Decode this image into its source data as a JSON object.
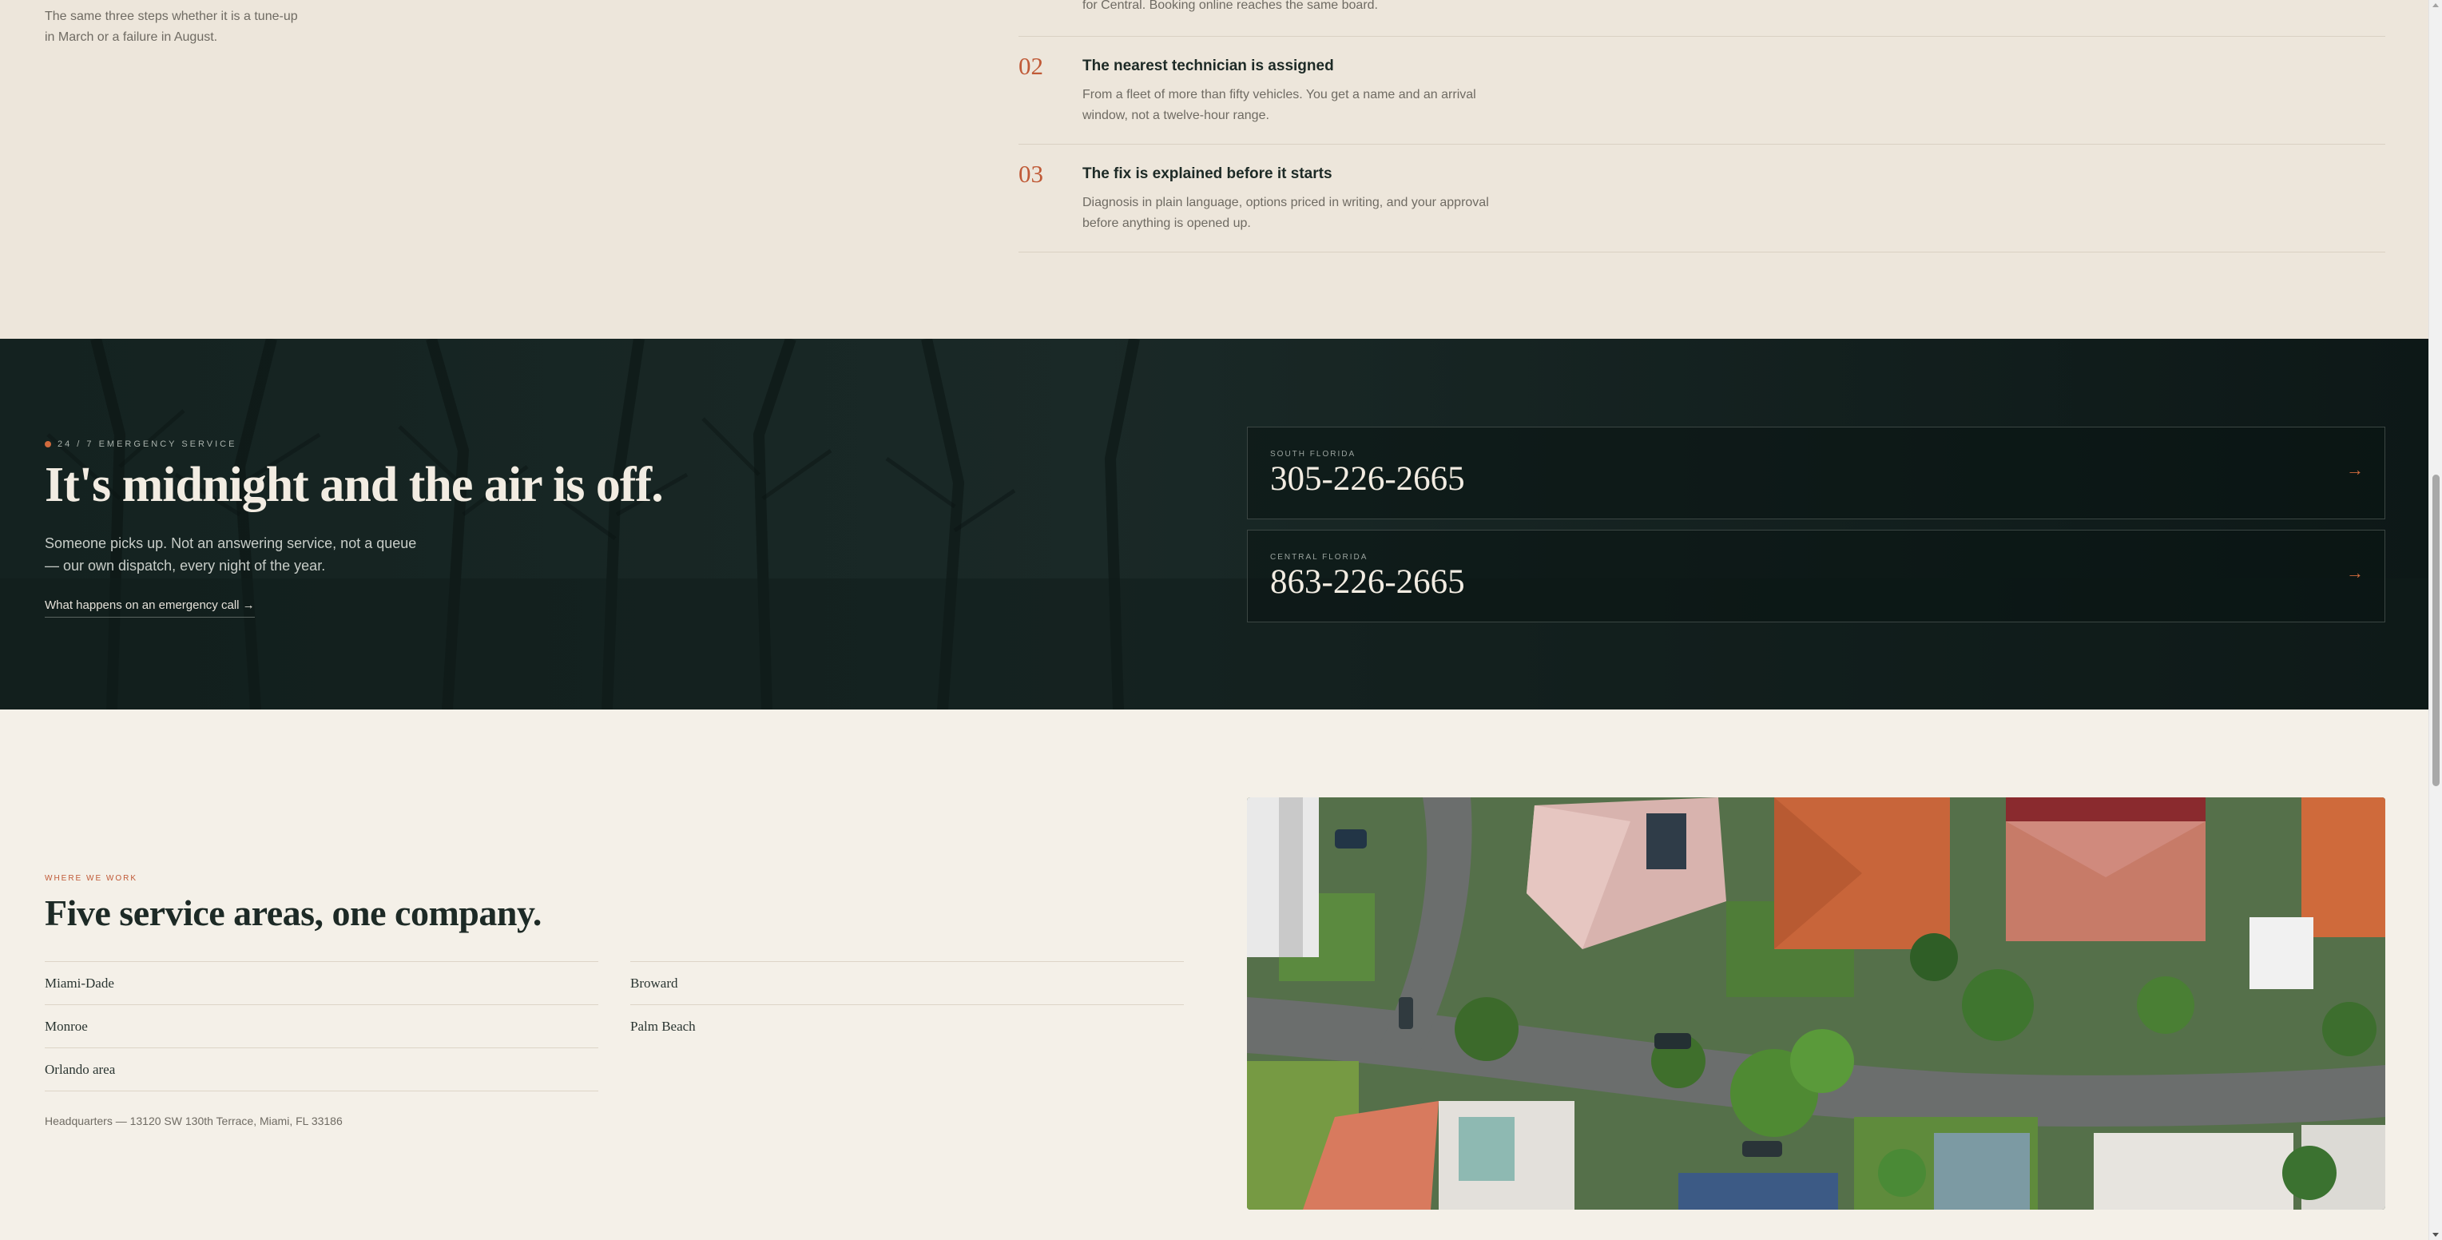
{
  "steps": {
    "intro": "The same three steps whether it is a tune-up in March or a failure in August.",
    "partial_desc": "for Central. Booking online reaches the same board.",
    "items": [
      {
        "num": "02",
        "title": "The nearest technician is assigned",
        "desc": "From a fleet of more than fifty vehicles. You get a name and an arrival window, not a twelve-hour range."
      },
      {
        "num": "03",
        "title": "The fix is explained before it starts",
        "desc": "Diagnosis in plain language, options priced in writing, and your approval before anything is opened up."
      }
    ]
  },
  "emergency": {
    "kicker": "24 / 7 EMERGENCY SERVICE",
    "title": "It's midnight and the air is off.",
    "desc": "Someone picks up. Not an answering service, not a queue — our own dispatch, every night of the year.",
    "link": "What happens on an emergency call →",
    "phones": [
      {
        "label": "SOUTH FLORIDA",
        "number": "305-226-2665",
        "arrow": "→"
      },
      {
        "label": "CENTRAL FLORIDA",
        "number": "863-226-2665",
        "arrow": "→"
      }
    ]
  },
  "areas": {
    "kicker": "WHERE WE WORK",
    "title": "Five service areas, one company.",
    "left": [
      "Miami-Dade",
      "Monroe",
      "Orlando area"
    ],
    "right": [
      "Broward",
      "Palm Beach"
    ],
    "hq": "Headquarters — 13120 SW 130th Terrace, Miami, FL 33186"
  },
  "colors": {
    "accent": "#c05a37",
    "dark_bg": "#0f1b1a",
    "cream_bg": "#f4f0e8",
    "section_bg": "#ede6db"
  }
}
